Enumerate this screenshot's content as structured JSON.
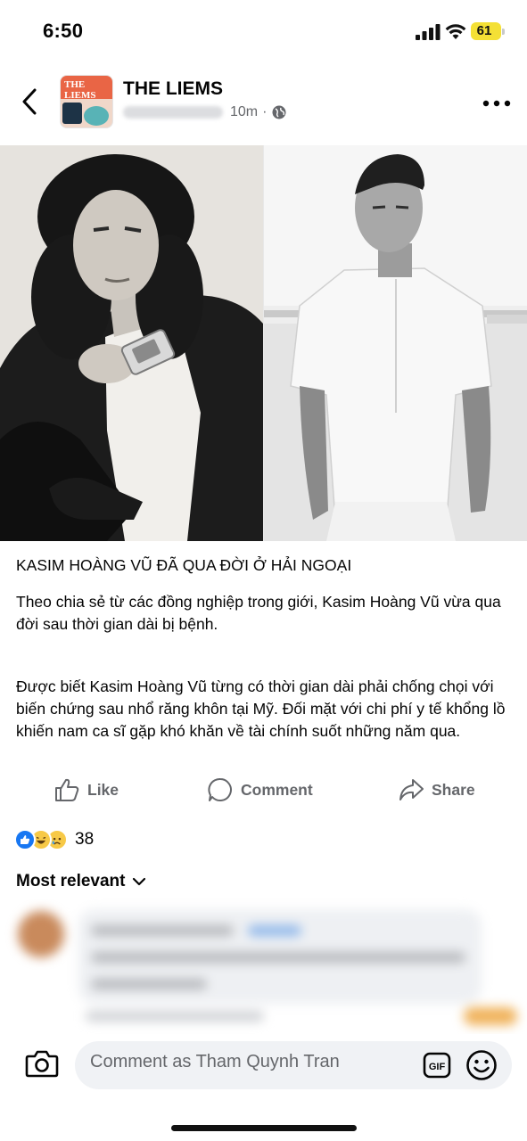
{
  "status_bar": {
    "time": "6:50",
    "battery_level": "61",
    "battery_color": "#f4e035"
  },
  "header": {
    "page_name": "THE LIEMS",
    "avatar_text": "THE LIEMS",
    "timestamp": "10m",
    "separator": "·",
    "icons": [
      "back-arrow-icon",
      "globe-icon",
      "more-icon"
    ]
  },
  "photos": [
    {
      "name": "photo-left"
    },
    {
      "name": "photo-right"
    }
  ],
  "post": {
    "headline": "KASIM HOÀNG VŨ ĐÃ QUA ĐỜI Ở HẢI NGOẠI",
    "paragraph1": "Theo chia sẻ từ các đồng nghiệp trong giới, Kasim Hoàng Vũ vừa qua đời sau thời gian dài bị bệnh.",
    "paragraph2": "Được biết Kasim Hoàng Vũ từng có thời gian dài phải chống chọi với biến chứng sau nhổ răng khôn tại Mỹ. Đối mặt với chi phí y tế khổng lồ khiến nam ca sĩ gặp khó khăn về tài chính suốt những năm qua."
  },
  "actions": {
    "like": "Like",
    "comment": "Comment",
    "share": "Share"
  },
  "reactions": {
    "count": "38",
    "types": [
      "like-reaction-icon",
      "haha-reaction-icon",
      "sad-reaction-icon"
    ],
    "colors": {
      "like": "#1877f2",
      "emoji": "#f7c947"
    }
  },
  "comments": {
    "sort_label": "Most relevant"
  },
  "composer": {
    "placeholder": "Comment as Tham Quynh Tran",
    "gif_label": "GIF",
    "icons": [
      "camera-icon",
      "gif-icon",
      "emoji-icon"
    ]
  }
}
